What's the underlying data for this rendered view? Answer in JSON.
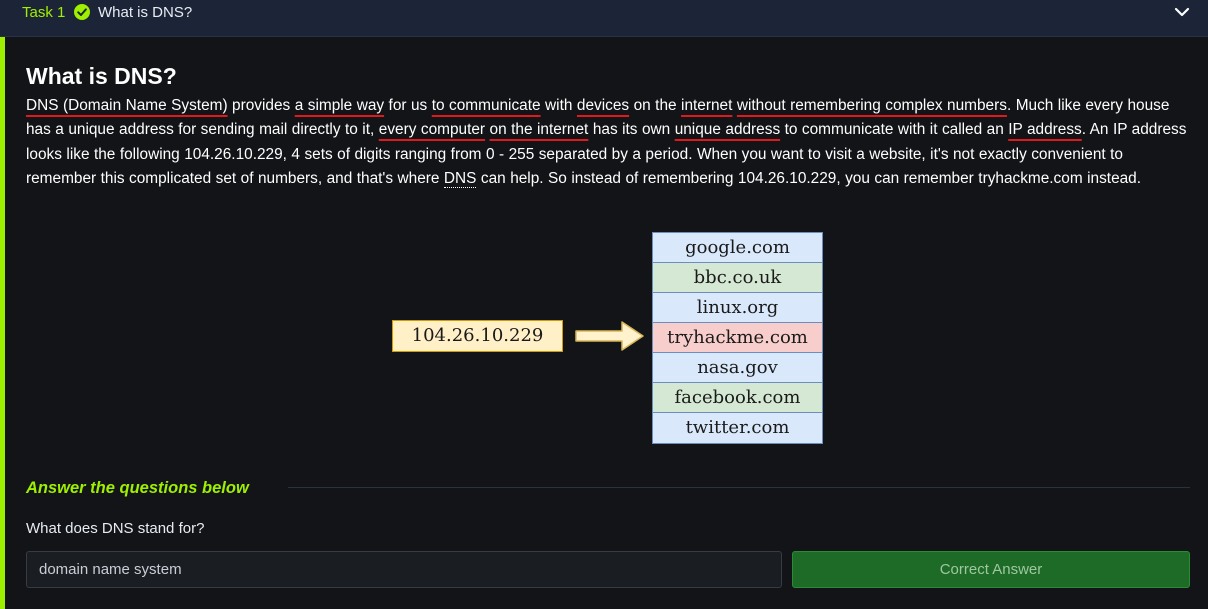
{
  "task": {
    "label": "Task 1",
    "title": "What is DNS?",
    "status_icon": "check-circle-icon",
    "expand_icon": "chevron-down-icon"
  },
  "content": {
    "heading": "What is DNS?",
    "paragraph": {
      "p1": "DNS (Domain Name System)",
      "p2": " provides ",
      "p3": "a simple way",
      "p4": " for us ",
      "p5": "to communicate",
      "p6": " with ",
      "p7": "devices",
      "p8": " on the ",
      "p9": "internet",
      "p10": " ",
      "p11": "without remembering complex numbers",
      "p12": ". Much like every house has a unique address for sending mail directly to it, ",
      "p13": "every computer",
      "p14": " ",
      "p15": "on the internet",
      "p16": " has its own ",
      "p17": "unique address",
      "p18": " to communicate with it called an ",
      "p19": "IP address",
      "p20": ". An IP address looks like the following ",
      "p21": "104.26.10.229",
      "p22": ", 4 sets of digits ranging from 0 - 255 separated by a period. When you want to visit a website, it's not exactly convenient to remember this complicated set of numbers, and that's where ",
      "p23": "DNS",
      "p24": " can help. So instead of remembering ",
      "p25": "104.26.10.229",
      "p26": ", you can remember ",
      "p27": "tryhackme.com",
      "p28": " instead."
    }
  },
  "diagram": {
    "ip": "104.26.10.229",
    "arrow_icon": "arrow-right-icon",
    "domains": [
      "google.com",
      "bbc.co.uk",
      "linux.org",
      "tryhackme.com",
      "nasa.gov",
      "facebook.com",
      "twitter.com"
    ]
  },
  "answers": {
    "heading": "Answer the questions below",
    "question": "What does DNS stand for?",
    "input_value": "domain name system",
    "button_label": "Correct Answer"
  },
  "colors": {
    "accent": "#9fef00",
    "header_bg": "#1c2538",
    "underline": "#e0191f",
    "correct_button": "#1e6b28"
  }
}
